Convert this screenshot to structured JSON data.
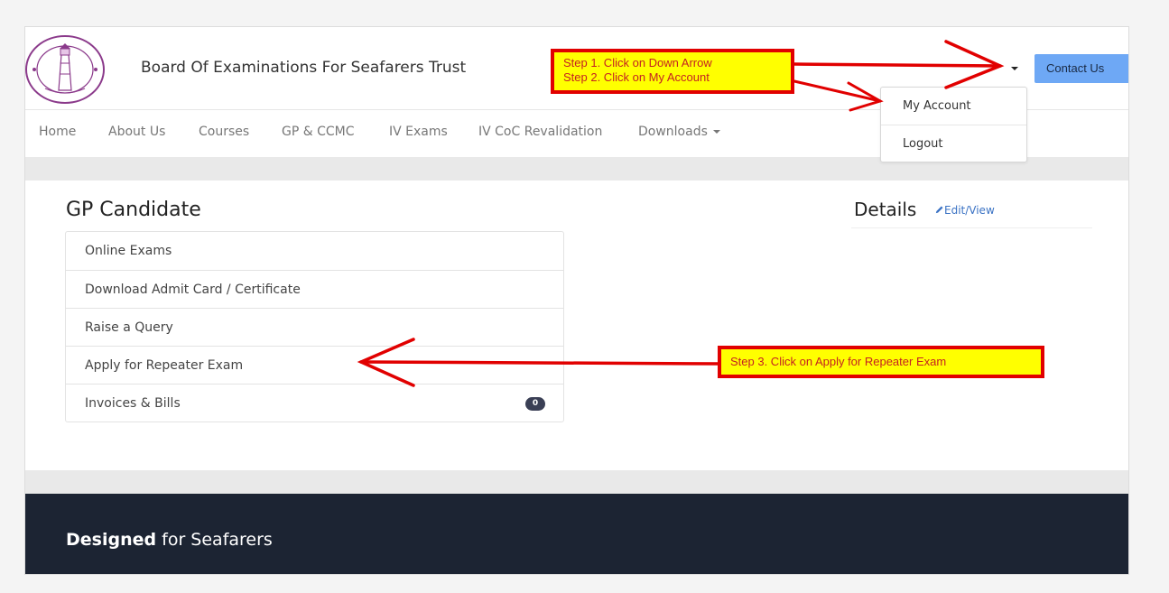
{
  "header": {
    "site_title": "Board Of Examinations For Seafarers Trust",
    "contact_label": "Contact Us",
    "logo_icon": "lighthouse-seal-logo",
    "logo_text": "IMEI CMMI BOARD OF EXAMINATIONS FOR SEAFARERS TRUST"
  },
  "user_dropdown": {
    "items": [
      {
        "label": "My Account"
      },
      {
        "label": "Logout"
      }
    ]
  },
  "nav": {
    "items": [
      {
        "label": "Home"
      },
      {
        "label": "About Us"
      },
      {
        "label": "Courses"
      },
      {
        "label": "GP & CCMC"
      },
      {
        "label": "IV Exams"
      },
      {
        "label": "IV CoC Revalidation"
      },
      {
        "label": "Downloads"
      }
    ]
  },
  "main": {
    "section_title": "GP Candidate",
    "menu": [
      {
        "label": "Online Exams"
      },
      {
        "label": "Download Admit Card / Certificate"
      },
      {
        "label": "Raise a Query"
      },
      {
        "label": "Apply for Repeater Exam"
      },
      {
        "label": "Invoices & Bills",
        "badge": "0"
      }
    ],
    "details_title": "Details",
    "edit_link": "Edit/View"
  },
  "footer": {
    "bold": "Designed",
    "rest": " for Seafarers"
  },
  "annotations": {
    "step1": "Step 1.  Click on Down Arrow",
    "step2": "Step 2.  Click on My Account",
    "step3": "Step 3. Click on Apply for Repeater Exam"
  },
  "colors": {
    "accent_button": "#6ea8f5",
    "footer_bg": "#1c2433",
    "annotation_red": "#e10000",
    "annotation_yellow": "#ffff00"
  }
}
